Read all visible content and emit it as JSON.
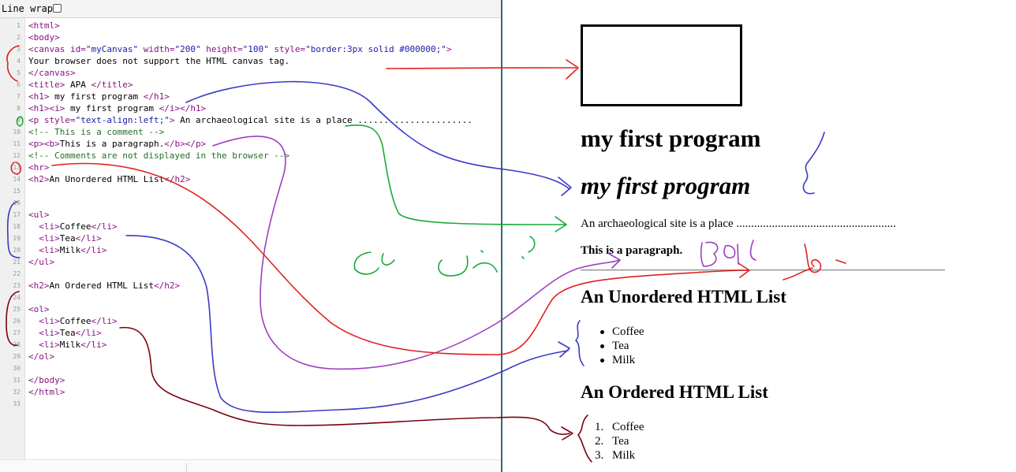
{
  "toolbar": {
    "line_wrap_label": "Line wrap"
  },
  "code_lines": [
    {
      "n": "1",
      "parts": [
        [
          "tag",
          "<html>"
        ]
      ]
    },
    {
      "n": "2",
      "parts": [
        [
          "tag",
          "<body>"
        ]
      ]
    },
    {
      "n": "3",
      "parts": [
        [
          "tag",
          "<canvas "
        ],
        [
          "tag",
          "id="
        ],
        [
          "str",
          "\"myCanvas\" "
        ],
        [
          "tag",
          "width="
        ],
        [
          "str",
          "\"200\" "
        ],
        [
          "tag",
          "height="
        ],
        [
          "str",
          "\"100\" "
        ],
        [
          "tag",
          "style="
        ],
        [
          "str",
          "\"border:3px solid #000000;\""
        ],
        [
          "tag",
          ">"
        ]
      ]
    },
    {
      "n": "4",
      "parts": [
        [
          "txt",
          "Your browser does not support the HTML canvas tag."
        ]
      ]
    },
    {
      "n": "5",
      "parts": [
        [
          "tag",
          "</canvas>"
        ]
      ]
    },
    {
      "n": "6",
      "parts": [
        [
          "tag",
          "<title>"
        ],
        [
          "txt",
          " APA "
        ],
        [
          "tag",
          "</title>"
        ]
      ]
    },
    {
      "n": "7",
      "parts": [
        [
          "tag",
          "<h1>"
        ],
        [
          "txt",
          " my first program "
        ],
        [
          "tag",
          "</h1>"
        ]
      ]
    },
    {
      "n": "8",
      "parts": [
        [
          "tag",
          "<h1><i>"
        ],
        [
          "txt",
          " my first program "
        ],
        [
          "tag",
          "</i></h1>"
        ]
      ]
    },
    {
      "n": "9",
      "parts": [
        [
          "tag",
          "<p "
        ],
        [
          "tag",
          "style="
        ],
        [
          "str",
          "\"text-align:left;\""
        ],
        [
          "tag",
          ">"
        ],
        [
          "txt",
          " An archaeological site is a place ......................"
        ]
      ]
    },
    {
      "n": "10",
      "parts": [
        [
          "cm",
          "<!-- This is a comment -->"
        ]
      ]
    },
    {
      "n": "11",
      "parts": [
        [
          "tag",
          "<p><b>"
        ],
        [
          "txt",
          "This is a paragraph."
        ],
        [
          "tag",
          "</b></p>"
        ]
      ]
    },
    {
      "n": "12",
      "parts": [
        [
          "cm",
          "<!-- Comments are not displayed in the browser -->"
        ]
      ]
    },
    {
      "n": "13",
      "parts": [
        [
          "tag",
          "<hr>"
        ]
      ]
    },
    {
      "n": "14",
      "parts": [
        [
          "tag",
          "<h2>"
        ],
        [
          "txt",
          "An Unordered HTML List"
        ],
        [
          "tag",
          "</h2>"
        ]
      ]
    },
    {
      "n": "15",
      "parts": []
    },
    {
      "n": "16",
      "parts": []
    },
    {
      "n": "17",
      "parts": [
        [
          "tag",
          "<ul>"
        ]
      ]
    },
    {
      "n": "18",
      "parts": [
        [
          "txt",
          "  "
        ],
        [
          "tag",
          "<li>"
        ],
        [
          "txt",
          "Coffee"
        ],
        [
          "tag",
          "</li>"
        ]
      ]
    },
    {
      "n": "19",
      "parts": [
        [
          "txt",
          "  "
        ],
        [
          "tag",
          "<li>"
        ],
        [
          "txt",
          "Tea"
        ],
        [
          "tag",
          "</li>"
        ]
      ]
    },
    {
      "n": "20",
      "parts": [
        [
          "txt",
          "  "
        ],
        [
          "tag",
          "<li>"
        ],
        [
          "txt",
          "Milk"
        ],
        [
          "tag",
          "</li>"
        ]
      ]
    },
    {
      "n": "21",
      "parts": [
        [
          "tag",
          "</ul>"
        ]
      ]
    },
    {
      "n": "22",
      "parts": []
    },
    {
      "n": "23",
      "parts": [
        [
          "tag",
          "<h2>"
        ],
        [
          "txt",
          "An Ordered HTML List"
        ],
        [
          "tag",
          "</h2>"
        ]
      ]
    },
    {
      "n": "24",
      "parts": []
    },
    {
      "n": "25",
      "parts": [
        [
          "tag",
          "<ol>"
        ]
      ]
    },
    {
      "n": "26",
      "parts": [
        [
          "txt",
          "  "
        ],
        [
          "tag",
          "<li>"
        ],
        [
          "txt",
          "Coffee"
        ],
        [
          "tag",
          "</li>"
        ]
      ]
    },
    {
      "n": "27",
      "parts": [
        [
          "txt",
          "  "
        ],
        [
          "tag",
          "<li>"
        ],
        [
          "txt",
          "Tea"
        ],
        [
          "tag",
          "</li>"
        ]
      ]
    },
    {
      "n": "28",
      "parts": [
        [
          "txt",
          "  "
        ],
        [
          "tag",
          "<li>"
        ],
        [
          "txt",
          "Milk"
        ],
        [
          "tag",
          "</li>"
        ]
      ]
    },
    {
      "n": "29",
      "parts": [
        [
          "tag",
          "</ol>"
        ]
      ]
    },
    {
      "n": "30",
      "parts": []
    },
    {
      "n": "31",
      "parts": [
        [
          "tag",
          "</body>"
        ]
      ]
    },
    {
      "n": "32",
      "parts": [
        [
          "tag",
          "</html>"
        ]
      ]
    },
    {
      "n": "33",
      "parts": []
    }
  ],
  "preview": {
    "heading1": "my first program",
    "heading1_italic": "my first program",
    "paragraph": "An archaeological site is a place ......................................................",
    "bold_paragraph": "This is a paragraph.",
    "ul_heading": "An Unordered HTML List",
    "ul_items": [
      "Coffee",
      "Tea",
      "Milk"
    ],
    "ol_heading": "An Ordered HTML List",
    "ol_items": [
      "Coffee",
      "Tea",
      "Milk"
    ]
  },
  "colors": {
    "divider": "#2e6b78",
    "ink_red": "#e02020",
    "ink_blue": "#3a3ac8",
    "ink_green": "#1aa83a",
    "ink_purple": "#9b3fc0",
    "ink_darkred": "#7a0010"
  }
}
